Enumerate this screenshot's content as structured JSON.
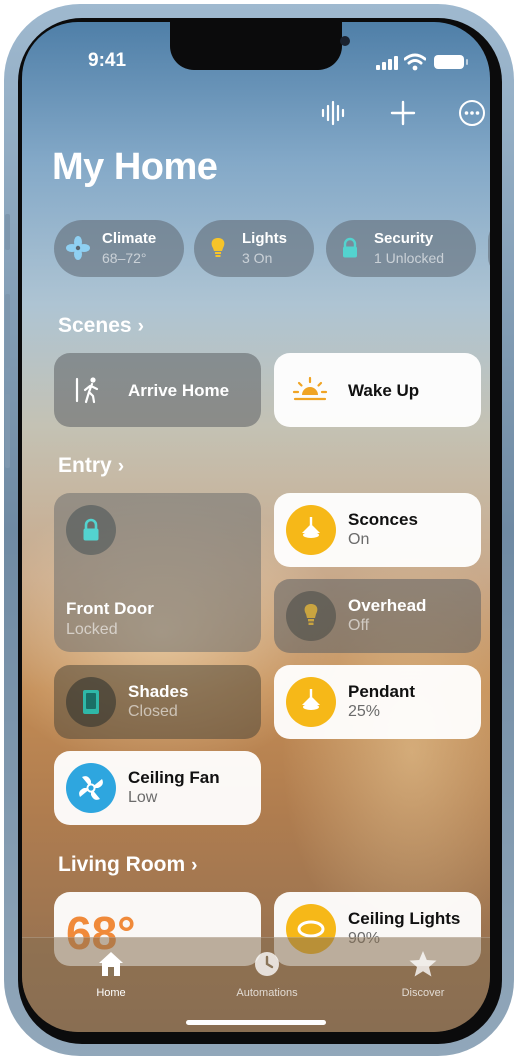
{
  "status": {
    "time": "9:41"
  },
  "header": {
    "title": "My Home"
  },
  "pills": [
    {
      "label": "Climate",
      "value": "68–72°",
      "icon": "fan-icon"
    },
    {
      "label": "Lights",
      "value": "3 On",
      "icon": "lightbulb-icon"
    },
    {
      "label": "Security",
      "value": "1 Unlocked",
      "icon": "lock-icon"
    }
  ],
  "sections": {
    "scenes": "Scenes",
    "entry": "Entry",
    "living_room": "Living Room"
  },
  "scenes": [
    {
      "name": "Arrive Home",
      "icon": "walking-person-icon",
      "active": false
    },
    {
      "name": "Wake Up",
      "icon": "sunrise-icon",
      "active": true
    }
  ],
  "entry": {
    "front_door": {
      "name": "Front Door",
      "status": "Locked"
    },
    "sconces": {
      "name": "Sconces",
      "status": "On"
    },
    "overhead": {
      "name": "Overhead",
      "status": "Off"
    },
    "shades": {
      "name": "Shades",
      "status": "Closed"
    },
    "pendant": {
      "name": "Pendant",
      "status": "25%"
    },
    "ceiling_fan": {
      "name": "Ceiling Fan",
      "status": "Low"
    }
  },
  "living_room": {
    "thermostat": {
      "value": "68°"
    },
    "ceiling_lights": {
      "name": "Ceiling Lights",
      "status": "90%"
    }
  },
  "tabbar": [
    {
      "label": "Home",
      "icon": "house-icon",
      "active": true
    },
    {
      "label": "Automations",
      "icon": "clock-icon",
      "active": false
    },
    {
      "label": "Discover",
      "icon": "star-icon",
      "active": false
    }
  ],
  "colors": {
    "accent_yellow": "#f6b818",
    "accent_blue": "#2ea6df",
    "accent_teal": "#53d3cf",
    "scene_orange": "#f0a424"
  }
}
